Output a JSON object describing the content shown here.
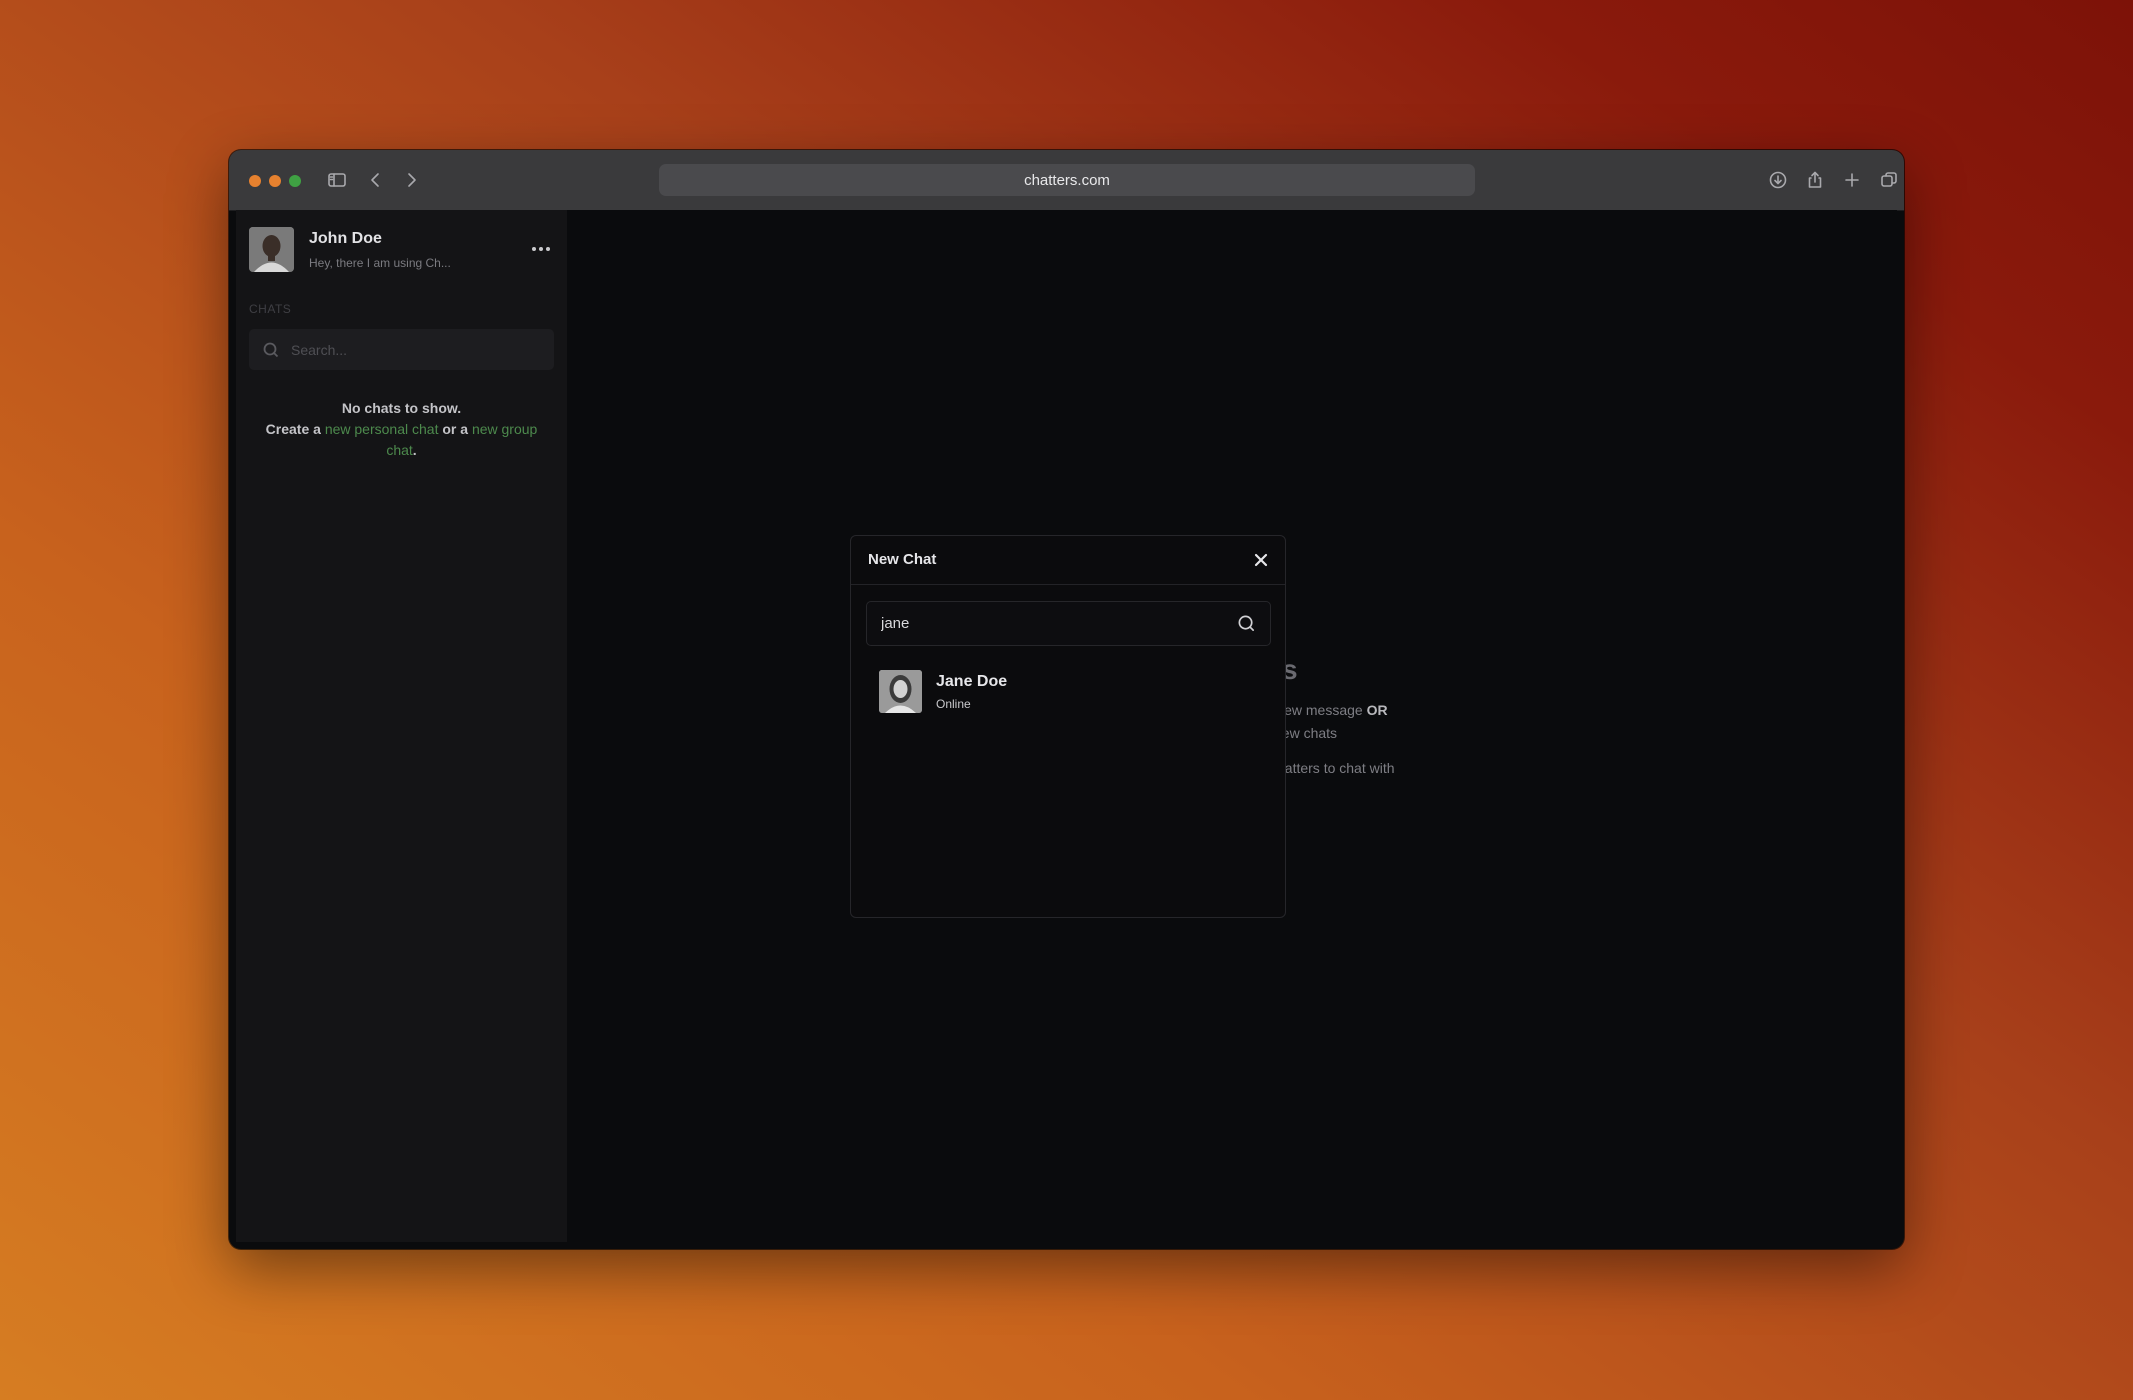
{
  "browser": {
    "url": "chatters.com"
  },
  "sidebar": {
    "profile": {
      "name": "John Doe",
      "status": "Hey, there I am using Ch..."
    },
    "section_label": "CHATS",
    "search_placeholder": "Search...",
    "empty": {
      "line1": "No chats to show.",
      "create_prefix": "Create a ",
      "personal_link": "new personal chat",
      "middle": " or a ",
      "group_link": "new group chat",
      "suffix": "."
    }
  },
  "main": {
    "welcome_title_fragment": "s",
    "welcome_line1_fragment": "view message",
    "welcome_line1_bold": "OR",
    "welcome_line2_fragment": "new chats",
    "welcome_line3_fragment": "hatters to chat with"
  },
  "modal": {
    "title": "New Chat",
    "search_value": "jane",
    "results": [
      {
        "name": "Jane Doe",
        "status": "Online"
      }
    ]
  },
  "colors": {
    "accent_link": "#4d8a4d",
    "traffic_red": "#e6812f",
    "traffic_yellow": "#e6812f",
    "traffic_green": "#3fa143"
  }
}
